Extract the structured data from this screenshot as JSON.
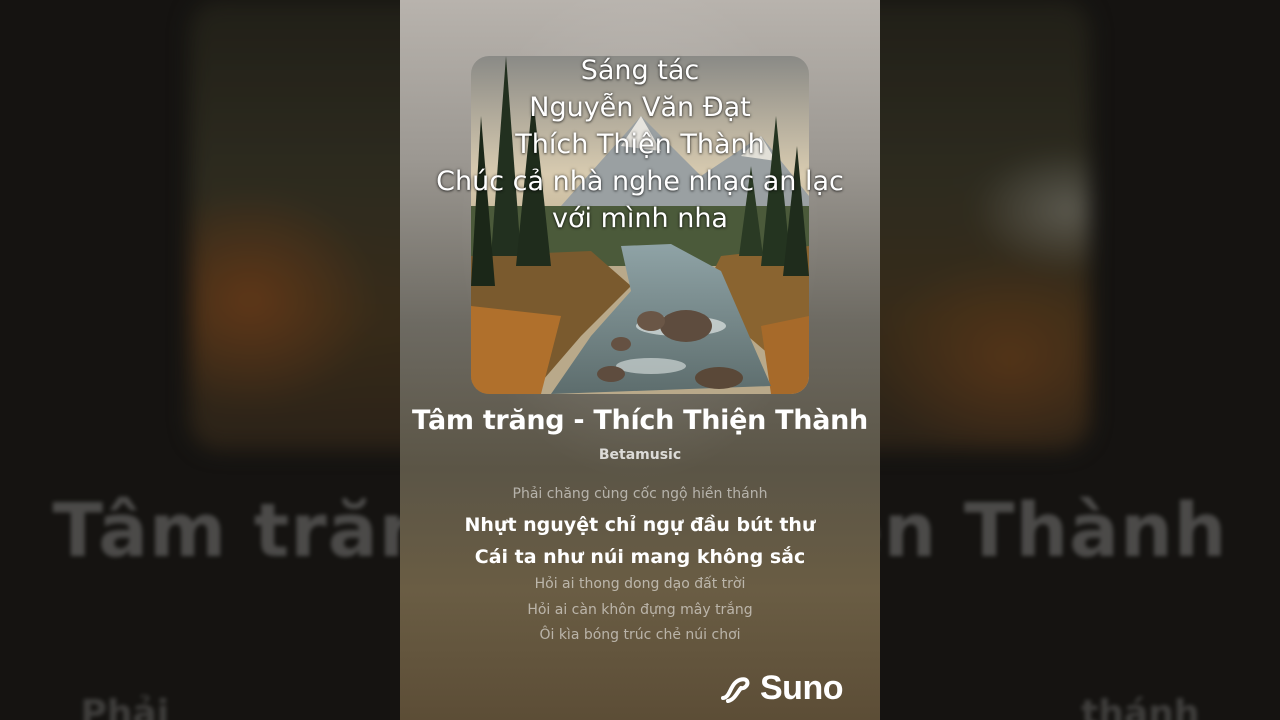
{
  "caption": {
    "lines": [
      "Sáng tác",
      "Nguyễn Văn Đạt",
      "Thích Thiện Thành",
      "Chúc cả nhà nghe nhạc an lạc",
      "với mình nha"
    ]
  },
  "song": {
    "title": "Tâm trăng - Thích Thiện Thành",
    "artist": "Betamusic"
  },
  "lyrics": [
    "Phải chăng cùng cốc ngộ hiền thánh",
    "Nhựt nguyệt chỉ ngự đầu bút thư",
    "Cái ta như núi mang không sắc",
    "Hỏi ai thong dong dạo đất trời",
    "Hỏi ai càn khôn đựng mây trắng",
    "Ôi kìa bóng trúc chẻ núi chơi"
  ],
  "background": {
    "title_left": "Tâm trăn",
    "title_right": "ện Thành",
    "lyric_left": "Phải ch",
    "lyric_right": "thánh"
  },
  "branding": {
    "logo_text": "Suno",
    "icon": "suno-logo-icon"
  }
}
